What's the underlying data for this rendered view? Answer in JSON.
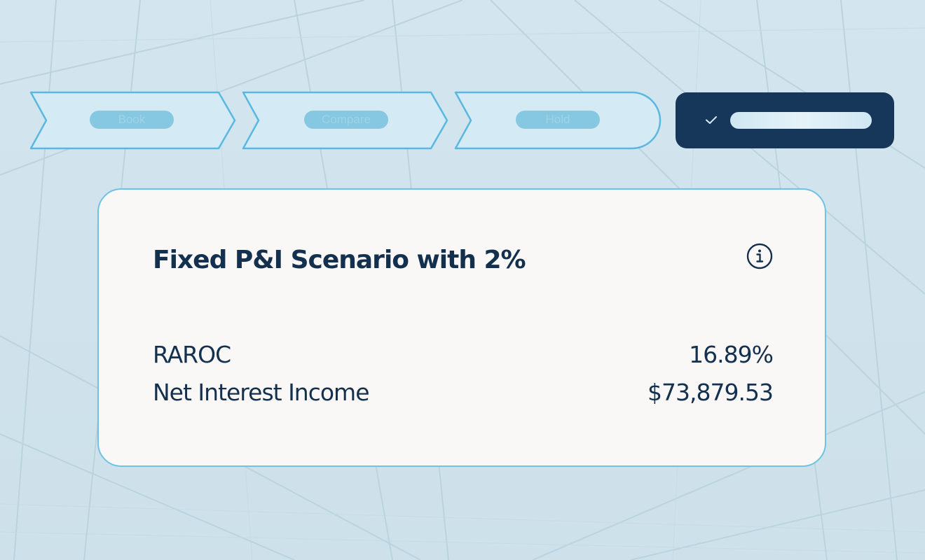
{
  "steps": [
    {
      "label": "Book",
      "state": "done"
    },
    {
      "label": "Compare",
      "state": "done"
    },
    {
      "label": "Hold",
      "state": "done"
    },
    {
      "label": "",
      "state": "active"
    }
  ],
  "card": {
    "title": "Fixed P&I Scenario with 2%",
    "metrics": [
      {
        "label": "RAROC",
        "value": "16.89%"
      },
      {
        "label": "Net Interest Income",
        "value": "$73,879.53"
      }
    ]
  },
  "icons": {
    "info": "info-icon",
    "check": "check-icon"
  },
  "colors": {
    "background": "#d3e5ee",
    "step_fill": "#d4eaf5",
    "step_border": "#5ab8e0",
    "step_pill": "#86c8e2",
    "active_step": "#16365a",
    "card_bg": "#f9f8f6",
    "card_border": "#6fc2e3",
    "text": "#14304f"
  }
}
